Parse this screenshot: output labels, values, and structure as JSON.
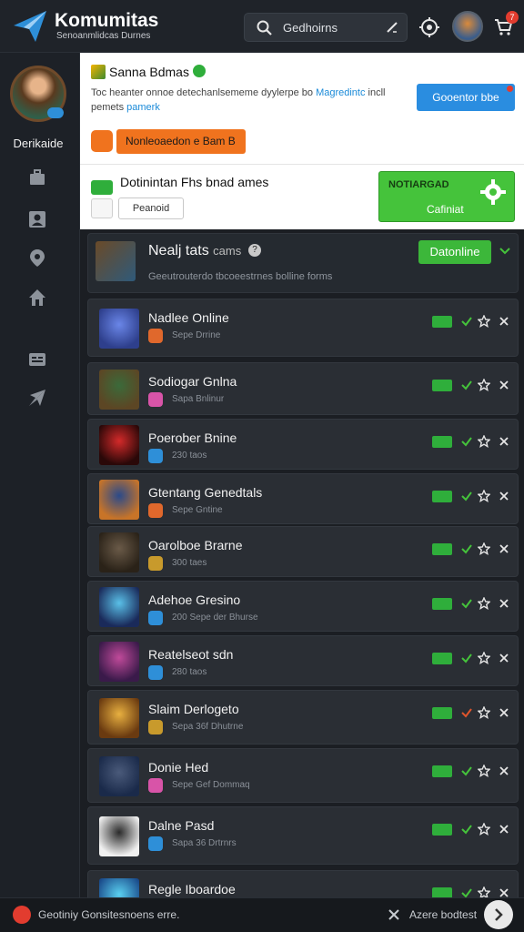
{
  "header": {
    "app_title": "Komumitas",
    "app_subtitle": "Senoanmlidcas Durnes",
    "search_value": "Gedhoirns",
    "cart_count": "7"
  },
  "sidebar": {
    "user_name": "Derikaide",
    "items": [
      {
        "icon": "briefcase-icon"
      },
      {
        "icon": "user-icon"
      },
      {
        "icon": "location-pin-icon"
      },
      {
        "icon": "home-icon"
      },
      {
        "icon": "id-card-icon"
      },
      {
        "icon": "plane-icon"
      }
    ]
  },
  "promo": {
    "title": "Sanna Bdmas",
    "desc_line1": "Toc heanter onnoe detechanlsememe dyylerpe bo",
    "desc_line1_link": "Magredintc",
    "desc_line1_tail": "incll",
    "desc_line2": "pemets",
    "desc_line2_link": "pamerk",
    "blue_button": "Gooentor bbe",
    "orange_button": "Nonleoaedon e Bam",
    "orange_button_tail": "B",
    "section_title": "Dotinintan Fhs bnad ames",
    "outline_button": "Peanoid",
    "green_button_line1": "NOTIARGAD",
    "green_button_line2": "Cafiniat"
  },
  "featured": {
    "title": "Nealj tats",
    "title_small": "cams",
    "desc": "Geeutrouterdo tbcoeestrnes bolline forms",
    "button": "Datonline"
  },
  "games": [
    {
      "name": "Nadlee Online",
      "sub": "Sepe Drrine",
      "colors": [
        "#2e3f8c",
        "#6a86e8"
      ],
      "sub_color": "#e0682c"
    },
    {
      "name": "Sodiogar Gnlna",
      "sub": "Sapa Bnlinur",
      "colors": [
        "#5c4624",
        "#3b6a3a"
      ],
      "sub_color": "#d854a8"
    },
    {
      "name": "Poerober Bnine",
      "sub": "230 taos",
      "colors": [
        "#2a0808",
        "#d42a2a"
      ],
      "sub_color": "#2e8fd8"
    },
    {
      "name": "Gtentang Genedtals",
      "sub": "Sepe Gntine",
      "colors": [
        "#c87428",
        "#2a4a8a"
      ],
      "sub_color": "#e0682c"
    },
    {
      "name": "Oarolboe Brarne",
      "sub": "300 taes",
      "colors": [
        "#2a2218",
        "#6a5a48"
      ],
      "sub_color": "#c89a2c"
    },
    {
      "name": "Adehoe Gresino",
      "sub": "200 Sepe der Bhurse",
      "colors": [
        "#1a2a5a",
        "#5ac0e8"
      ],
      "sub_color": "#2e8fd8"
    },
    {
      "name": "Reatelseot sdn",
      "sub": "280 taos",
      "colors": [
        "#3a1a4a",
        "#c04a9a"
      ],
      "sub_color": "#2e8fd8"
    },
    {
      "name": "Slaim Derlogeto",
      "sub": "Sepa 36f Dhutrne",
      "colors": [
        "#6a3a10",
        "#e8b040"
      ],
      "sub_color": "#c89a2c"
    },
    {
      "name": "Donie Hed",
      "sub": "Sepe Gef Dommaq",
      "colors": [
        "#1a2a4a",
        "#4a5a7a"
      ],
      "sub_color": "#d854a8"
    },
    {
      "name": "Dalne Pasd",
      "sub": "Sapa 36 Drtrnrs",
      "colors": [
        "#f0f0f0",
        "#2a2a2a"
      ],
      "sub_color": "#2e8fd8"
    },
    {
      "name": "Regle Iboardoe",
      "sub": "",
      "colors": [
        "#1a4a8a",
        "#5ad0f0"
      ],
      "sub_color": "#2e8fd8"
    }
  ],
  "footer": {
    "text": "Geotiniy Gonsitesnoens erre.",
    "right_text": "Azere bodtest"
  }
}
